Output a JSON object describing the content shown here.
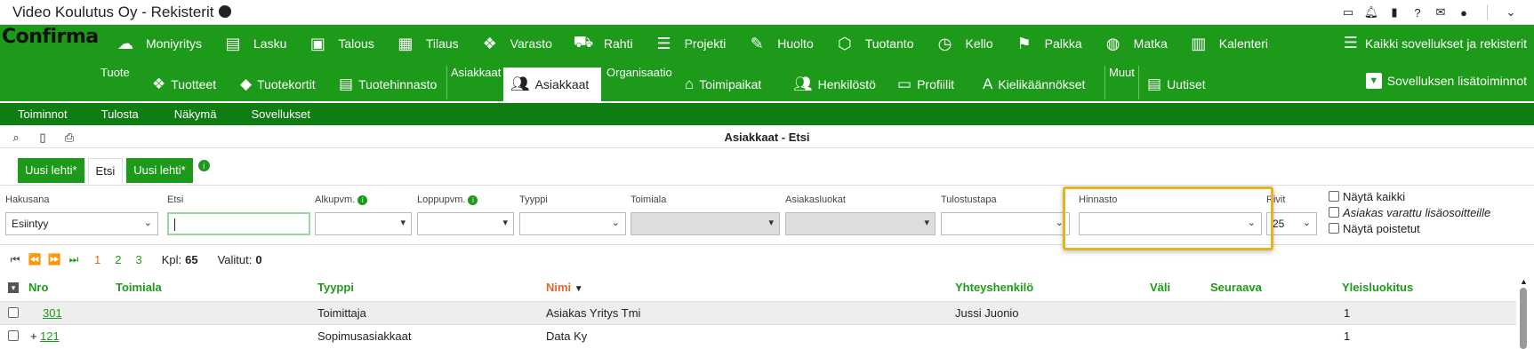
{
  "window": {
    "title": "Video Koulutus Oy - Rekisterit"
  },
  "logo": "Confirma",
  "modules": [
    {
      "label": "Moniyritys",
      "icon": "cloud-upload-icon",
      "glyph": "☁"
    },
    {
      "label": "Lasku",
      "icon": "document-icon",
      "glyph": "▤"
    },
    {
      "label": "Talous",
      "icon": "money-icon",
      "glyph": "▣"
    },
    {
      "label": "Tilaus",
      "icon": "grid-icon",
      "glyph": "▦"
    },
    {
      "label": "Varasto",
      "icon": "boxes-icon",
      "glyph": "❖"
    },
    {
      "label": "Rahti",
      "icon": "truck-icon",
      "glyph": "⛟"
    },
    {
      "label": "Projekti",
      "icon": "tasks-icon",
      "glyph": "☰"
    },
    {
      "label": "Huolto",
      "icon": "wrench-icon",
      "glyph": "✎"
    },
    {
      "label": "Tuotanto",
      "icon": "cube-icon",
      "glyph": "⬡"
    },
    {
      "label": "Kello",
      "icon": "clock-icon",
      "glyph": "◷"
    },
    {
      "label": "Palkka",
      "icon": "flag-icon",
      "glyph": "⚑"
    },
    {
      "label": "Matka",
      "icon": "globe-icon",
      "glyph": "◍"
    },
    {
      "label": "Kalenteri",
      "icon": "calendar-icon",
      "glyph": "▥"
    }
  ],
  "all_apps": "Kaikki sovellukset ja rekisterit",
  "groups": {
    "tuote": "Tuote",
    "asiakkaat": "Asiakkaat",
    "organisaatio": "Organisaatio",
    "muut": "Muut"
  },
  "subitems": {
    "tuotteet": "Tuotteet",
    "tuotekortit": "Tuotekortit",
    "tuotehinnasto": "Tuotehinnasto",
    "asiakkaat": "Asiakkaat",
    "toimipaikat": "Toimipaikat",
    "henkilosto": "Henkilöstö",
    "profiilit": "Profiilit",
    "kielikaannokset": "Kielikäännökset",
    "uutiset": "Uutiset"
  },
  "addon": "Sovelluksen lisätoiminnot",
  "menubar": [
    "Toiminnot",
    "Tulosta",
    "Näkymä",
    "Sovellukset"
  ],
  "page_title": "Asiakkaat - Etsi",
  "tabs": [
    "Uusi lehti*",
    "Etsi",
    "Uusi lehti*"
  ],
  "filters": {
    "hakusana_label": "Hakusana",
    "hakusana_value": "Esiintyy",
    "etsi_label": "Etsi",
    "alkupvm_label": "Alkupvm.",
    "loppupvm_label": "Loppupvm.",
    "tyyppi_label": "Tyyppi",
    "toimiala_label": "Toimiala",
    "asiakasluokat_label": "Asiakasluokat",
    "tulostustapa_label": "Tulostustapa",
    "hinnasto_label": "Hinnasto",
    "rivit_label": "Rivit",
    "rivit_value": "25",
    "nayta_kaikki": "Näytä kaikki",
    "asiakas_varattu": "Asiakas varattu lisäosoitteille",
    "nayta_poistetut": "Näytä poistetut"
  },
  "pager": {
    "pages": [
      "1",
      "2",
      "3"
    ],
    "kpl_label": "Kpl:",
    "kpl_value": "65",
    "valitut_label": "Valitut:",
    "valitut_value": "0"
  },
  "columns": {
    "nro": "Nro",
    "toimiala": "Toimiala",
    "tyyppi": "Tyyppi",
    "nimi": "Nimi",
    "yhteyshenkilo": "Yhteyshenkilö",
    "vali": "Väli",
    "seuraava": "Seuraava",
    "yleisluokitus": "Yleisluokitus"
  },
  "rows": [
    {
      "nro": "301",
      "toimiala": "",
      "tyyppi": "Toimittaja",
      "nimi": "Asiakas Yritys Tmi",
      "yhteyshenkilo": "Jussi Juonio",
      "yleisluokitus": "1",
      "expand": ""
    },
    {
      "nro": "121",
      "toimiala": "",
      "tyyppi": "Sopimusasiakkaat",
      "nimi": "Data Ky",
      "yhteyshenkilo": "",
      "yleisluokitus": "1",
      "expand": "+"
    }
  ]
}
